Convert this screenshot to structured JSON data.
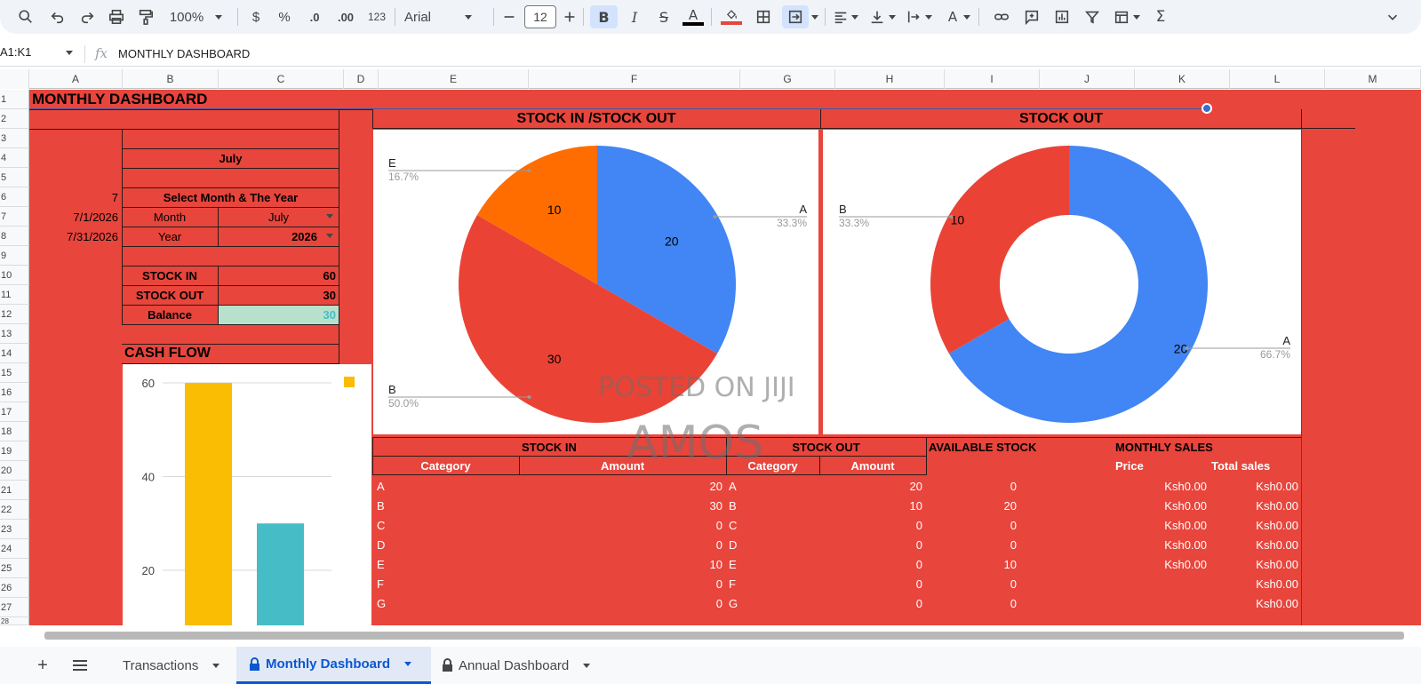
{
  "toolbar": {
    "zoom": "100%",
    "currency": "$",
    "percent": "%",
    "decrease_decimal": ".0",
    "increase_decimal": ".00",
    "number_format": "123",
    "font": "Arial",
    "font_size": "12"
  },
  "formula_bar": {
    "name_box": "A1:K1",
    "fx": "fx",
    "content": "MONTHLY DASHBOARD"
  },
  "columns": [
    "A",
    "B",
    "C",
    "D",
    "E",
    "F",
    "G",
    "H",
    "I",
    "J",
    "K",
    "L",
    "M"
  ],
  "rows": [
    "1",
    "2",
    "3",
    "4",
    "5",
    "6",
    "7",
    "8",
    "9",
    "10",
    "11",
    "12",
    "13",
    "14",
    "15",
    "16",
    "17",
    "18",
    "19",
    "20",
    "21",
    "22",
    "23",
    "24",
    "25",
    "26",
    "27",
    "28"
  ],
  "sheet": {
    "title": "MONTHLY DASHBOARD",
    "month_header": "July",
    "select_label": "Select Month & The Year",
    "month_number": "7",
    "start_date": "7/1/2026",
    "end_date": "7/31/2026",
    "month_label": "Month",
    "month_value": "July",
    "year_label": "Year",
    "year_value": "2026",
    "stock_in_label": "STOCK IN",
    "stock_in_value": "60",
    "stock_out_label": "STOCK OUT",
    "stock_out_value": "30",
    "balance_label": "Balance",
    "balance_value": "30",
    "cash_flow_label": "CASH FLOW",
    "pie_title": "STOCK IN /STOCK OUT",
    "donut_title": "STOCK OUT",
    "watermark_1": "POSTED ON JIJI",
    "watermark_2": "AMOS"
  },
  "table": {
    "stock_in_header": "STOCK IN",
    "stock_out_header": "STOCK OUT",
    "available_header": "AVAILABLE STOCK",
    "monthly_sales_header": "MONTHLY SALES",
    "category_label": "Category",
    "amount_label": "Amount",
    "price_label": "Price",
    "total_sales_label": "Total sales",
    "rows": [
      {
        "in_cat": "A",
        "in_amt": "20",
        "out_cat": "A",
        "out_amt": "20",
        "avail": "0",
        "price": "Ksh0.00",
        "total": "Ksh0.00"
      },
      {
        "in_cat": "B",
        "in_amt": "30",
        "out_cat": "B",
        "out_amt": "10",
        "avail": "20",
        "price": "Ksh0.00",
        "total": "Ksh0.00"
      },
      {
        "in_cat": "C",
        "in_amt": "0",
        "out_cat": "C",
        "out_amt": "0",
        "avail": "0",
        "price": "Ksh0.00",
        "total": "Ksh0.00"
      },
      {
        "in_cat": "D",
        "in_amt": "0",
        "out_cat": "D",
        "out_amt": "0",
        "avail": "0",
        "price": "Ksh0.00",
        "total": "Ksh0.00"
      },
      {
        "in_cat": "E",
        "in_amt": "10",
        "out_cat": "E",
        "out_amt": "0",
        "avail": "10",
        "price": "Ksh0.00",
        "total": "Ksh0.00"
      },
      {
        "in_cat": "F",
        "in_amt": "0",
        "out_cat": "F",
        "out_amt": "0",
        "avail": "0",
        "price": "",
        "total": "Ksh0.00"
      },
      {
        "in_cat": "G",
        "in_amt": "0",
        "out_cat": "G",
        "out_amt": "0",
        "avail": "0",
        "price": "",
        "total": "Ksh0.00"
      }
    ]
  },
  "tabs": [
    {
      "label": "Transactions",
      "locked": false,
      "active": false
    },
    {
      "label": "Monthly Dashboard",
      "locked": true,
      "active": true
    },
    {
      "label": "Annual Dashboard",
      "locked": true,
      "active": false
    }
  ],
  "colors": {
    "sheet_bg": "#e8453c",
    "blue": "#4285f4",
    "red": "#ea4335",
    "orange": "#ff6d01",
    "yellow": "#fbbc04",
    "teal": "#46bdc6",
    "balance_bg": "#b7e1cd"
  },
  "chart_data": [
    {
      "type": "pie",
      "title": "STOCK IN /STOCK OUT",
      "slices": [
        {
          "label": "A",
          "value": 20,
          "percent": "33.3%",
          "color": "#4285f4"
        },
        {
          "label": "B",
          "value": 30,
          "percent": "50.0%",
          "color": "#ea4335"
        },
        {
          "label": "E",
          "value": 10,
          "percent": "16.7%",
          "color": "#ff6d01"
        }
      ]
    },
    {
      "type": "pie",
      "title": "STOCK OUT",
      "donut": true,
      "slices": [
        {
          "label": "A",
          "value": 20,
          "percent": "66.7%",
          "color": "#4285f4"
        },
        {
          "label": "B",
          "value": 10,
          "percent": "33.3%",
          "color": "#ea4335"
        }
      ]
    },
    {
      "type": "bar",
      "title": "CASH FLOW",
      "categories": [
        "",
        ""
      ],
      "values": [
        60,
        30
      ],
      "colors": [
        "#fbbc04",
        "#46bdc6"
      ],
      "yticks": [
        20,
        40,
        60
      ],
      "ylim_visible": [
        14,
        60
      ]
    }
  ]
}
